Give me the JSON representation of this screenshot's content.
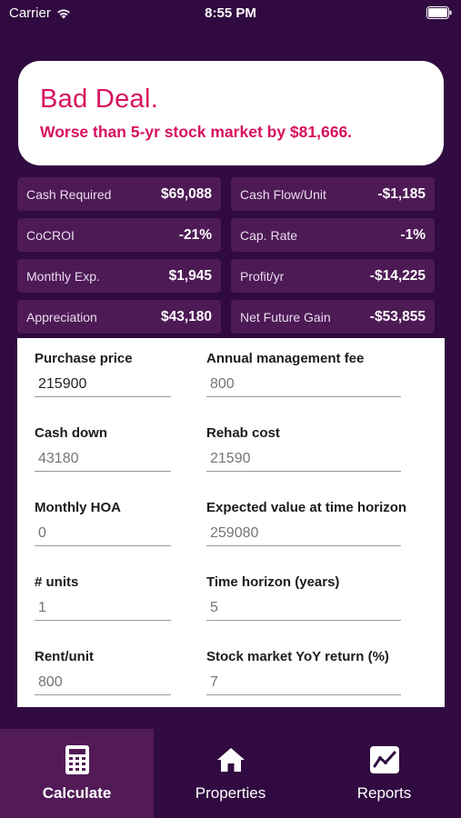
{
  "status_bar": {
    "carrier": "Carrier",
    "time": "8:55 PM"
  },
  "verdict": {
    "title": "Bad Deal.",
    "subtitle": "Worse than 5-yr stock market by $81,666."
  },
  "stats": [
    {
      "label": "Cash Required",
      "value": "$69,088"
    },
    {
      "label": "Cash Flow/Unit",
      "value": "-$1,185"
    },
    {
      "label": "CoCROI",
      "value": "-21%"
    },
    {
      "label": "Cap. Rate",
      "value": "-1%"
    },
    {
      "label": "Monthly Exp.",
      "value": "$1,945"
    },
    {
      "label": "Profit/yr",
      "value": "-$14,225"
    },
    {
      "label": "Appreciation",
      "value": "$43,180"
    },
    {
      "label": "Net Future Gain",
      "value": "-$53,855"
    }
  ],
  "form": {
    "purchase_price": {
      "label": "Purchase price",
      "value": "215900"
    },
    "management_fee": {
      "label": "Annual management fee",
      "placeholder": "800"
    },
    "cash_down": {
      "label": "Cash down",
      "placeholder": "43180"
    },
    "rehab_cost": {
      "label": "Rehab cost",
      "placeholder": "21590"
    },
    "monthly_hoa": {
      "label": "Monthly HOA",
      "placeholder": "0"
    },
    "expected_value": {
      "label": "Expected value at time horizon",
      "placeholder": "259080"
    },
    "units": {
      "label": "# units",
      "placeholder": "1"
    },
    "time_horizon": {
      "label": "Time horizon (years)",
      "placeholder": "5"
    },
    "rent_unit": {
      "label": "Rent/unit",
      "placeholder": "800"
    },
    "stock_return": {
      "label": "Stock market YoY return (%)",
      "placeholder": "7"
    }
  },
  "tabs": {
    "calculate": "Calculate",
    "properties": "Properties",
    "reports": "Reports"
  },
  "colors": {
    "background": "#300a40",
    "tile": "#4d1a55",
    "accent": "#d8115e",
    "placeholder": "#f2a2a6"
  }
}
